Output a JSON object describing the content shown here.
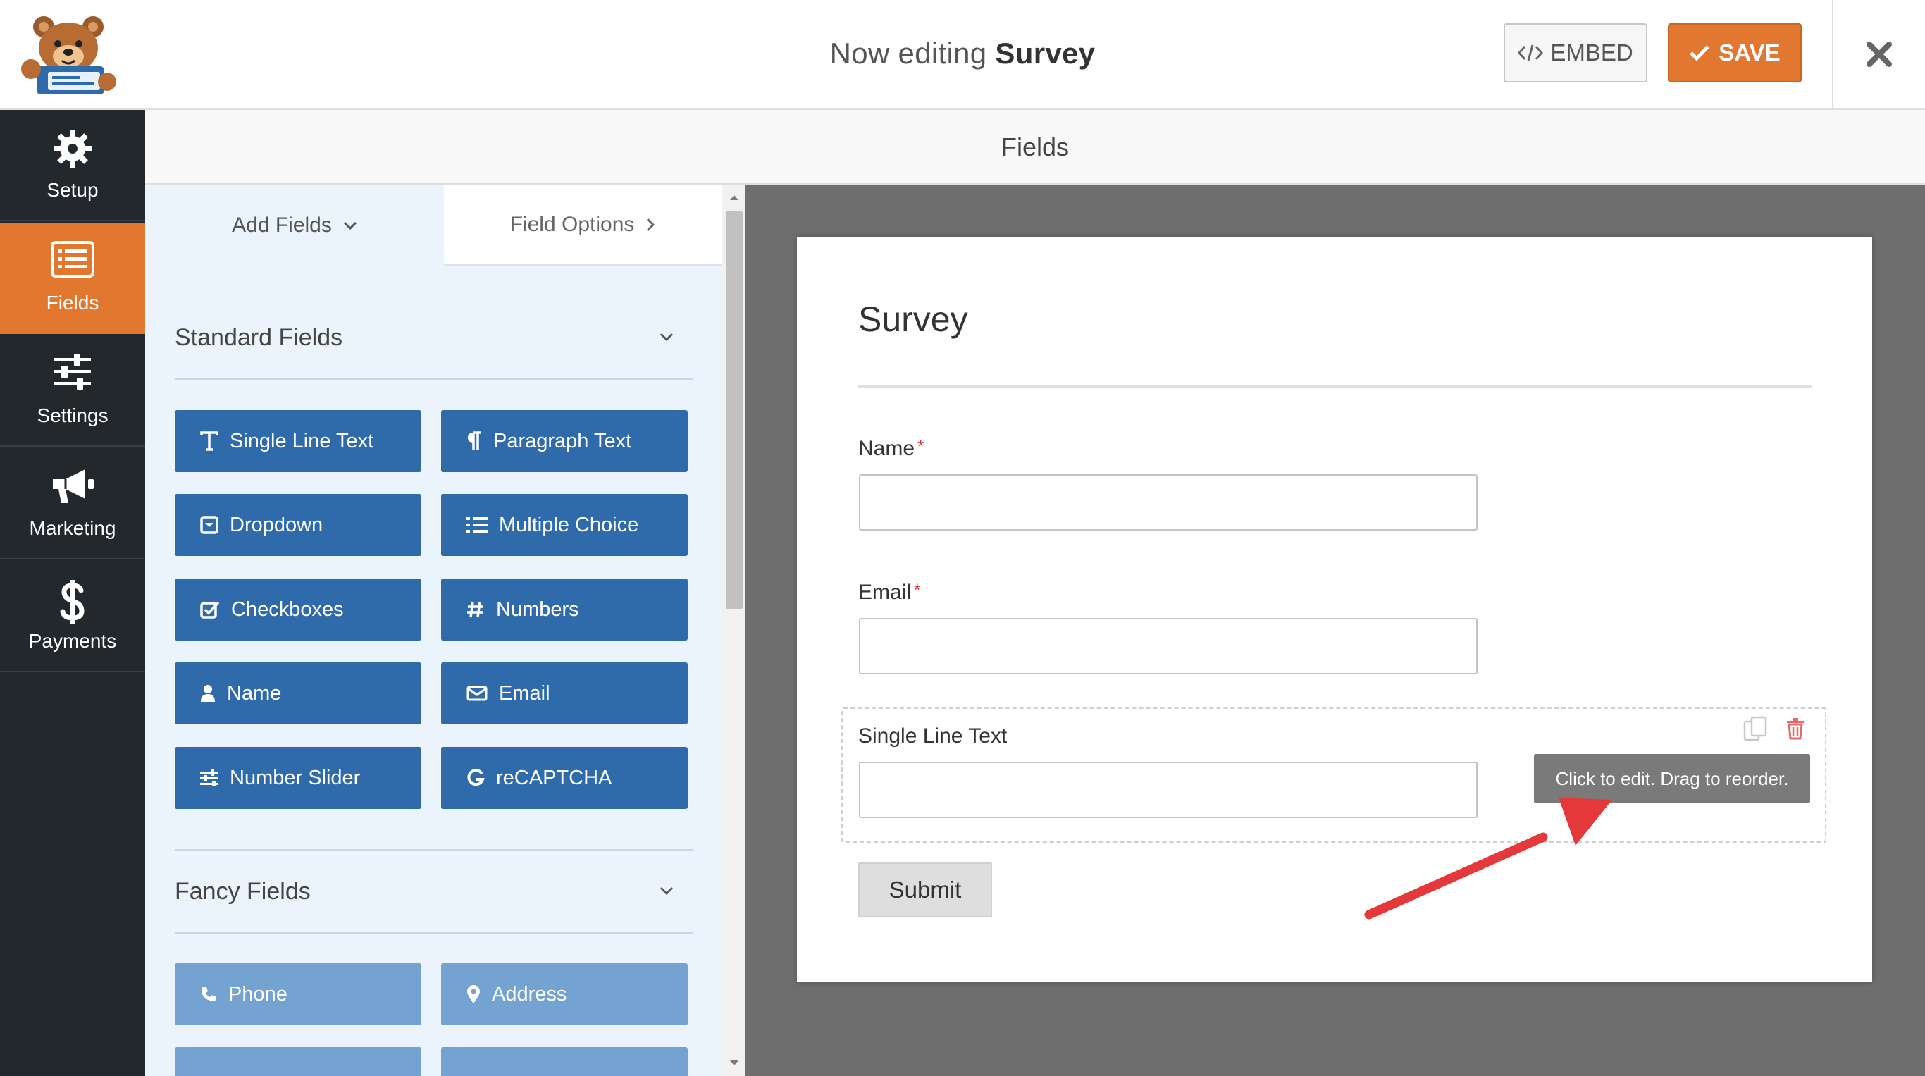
{
  "header": {
    "title_prefix": "Now editing",
    "title_form": "Survey",
    "embed_label": "EMBED",
    "save_label": "SAVE"
  },
  "nav": {
    "items": [
      {
        "label": "Setup",
        "icon": "gear-icon"
      },
      {
        "label": "Fields",
        "icon": "fields-list-icon"
      },
      {
        "label": "Settings",
        "icon": "sliders-icon"
      },
      {
        "label": "Marketing",
        "icon": "megaphone-icon"
      },
      {
        "label": "Payments",
        "icon": "dollar-icon"
      }
    ],
    "active": "Fields"
  },
  "subheader": {
    "title": "Fields"
  },
  "panel": {
    "tab_add": "Add Fields",
    "tab_options": "Field Options",
    "standard_title": "Standard Fields",
    "standard_fields": [
      "Single Line Text",
      "Paragraph Text",
      "Dropdown",
      "Multiple Choice",
      "Checkboxes",
      "Numbers",
      "Name",
      "Email",
      "Number Slider",
      "reCAPTCHA"
    ],
    "fancy_title": "Fancy Fields",
    "fancy_fields": [
      "Phone",
      "Address"
    ]
  },
  "form": {
    "title": "Survey",
    "fields": [
      {
        "label": "Name",
        "required": true
      },
      {
        "label": "Email",
        "required": true
      },
      {
        "label": "Single Line Text",
        "required": false
      }
    ],
    "required_mark": "*",
    "tooltip": "Click to edit. Drag to reorder.",
    "submit_label": "Submit"
  },
  "colors": {
    "accent_orange": "#e27730",
    "field_button_blue": "#2f6aaa",
    "fancy_button_blue": "#74a3d2",
    "nav_dark": "#23282d",
    "annotation_red": "#e5383b"
  }
}
